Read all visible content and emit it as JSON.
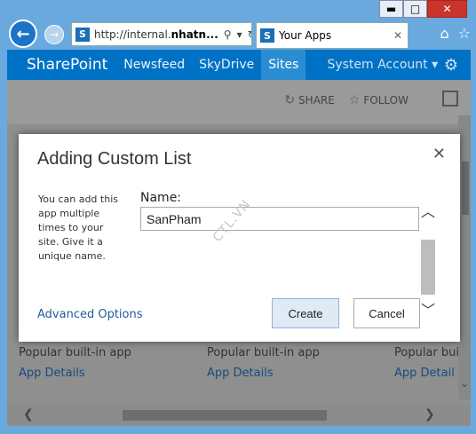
{
  "window": {
    "minimize": "▬",
    "maximize": "□",
    "close": "✕"
  },
  "browser": {
    "address": "http://internal.",
    "address_bold": "nhatn...",
    "tab_title": "Your Apps",
    "tab_close": "✕"
  },
  "suitebar": {
    "brand": "SharePoint",
    "nav": [
      "Newsfeed",
      "SkyDrive",
      "Sites"
    ],
    "account": "System Account ▾"
  },
  "page": {
    "share": "SHARE",
    "follow": "FOLLOW",
    "apps": [
      {
        "subtitle": "Popular built-in app",
        "link": "App Details"
      },
      {
        "subtitle": "Popular built-in app",
        "link": "App Details"
      },
      {
        "subtitle": "Popular bui",
        "link": "App Detail"
      }
    ]
  },
  "dialog": {
    "title": "Adding Custom List",
    "description": "You can add this app multiple times to your site. Give it a unique name.",
    "name_label": "Name:",
    "name_value": "SanPham",
    "watermark": "CTL.VN",
    "advanced": "Advanced Options",
    "create": "Create",
    "cancel": "Cancel"
  }
}
